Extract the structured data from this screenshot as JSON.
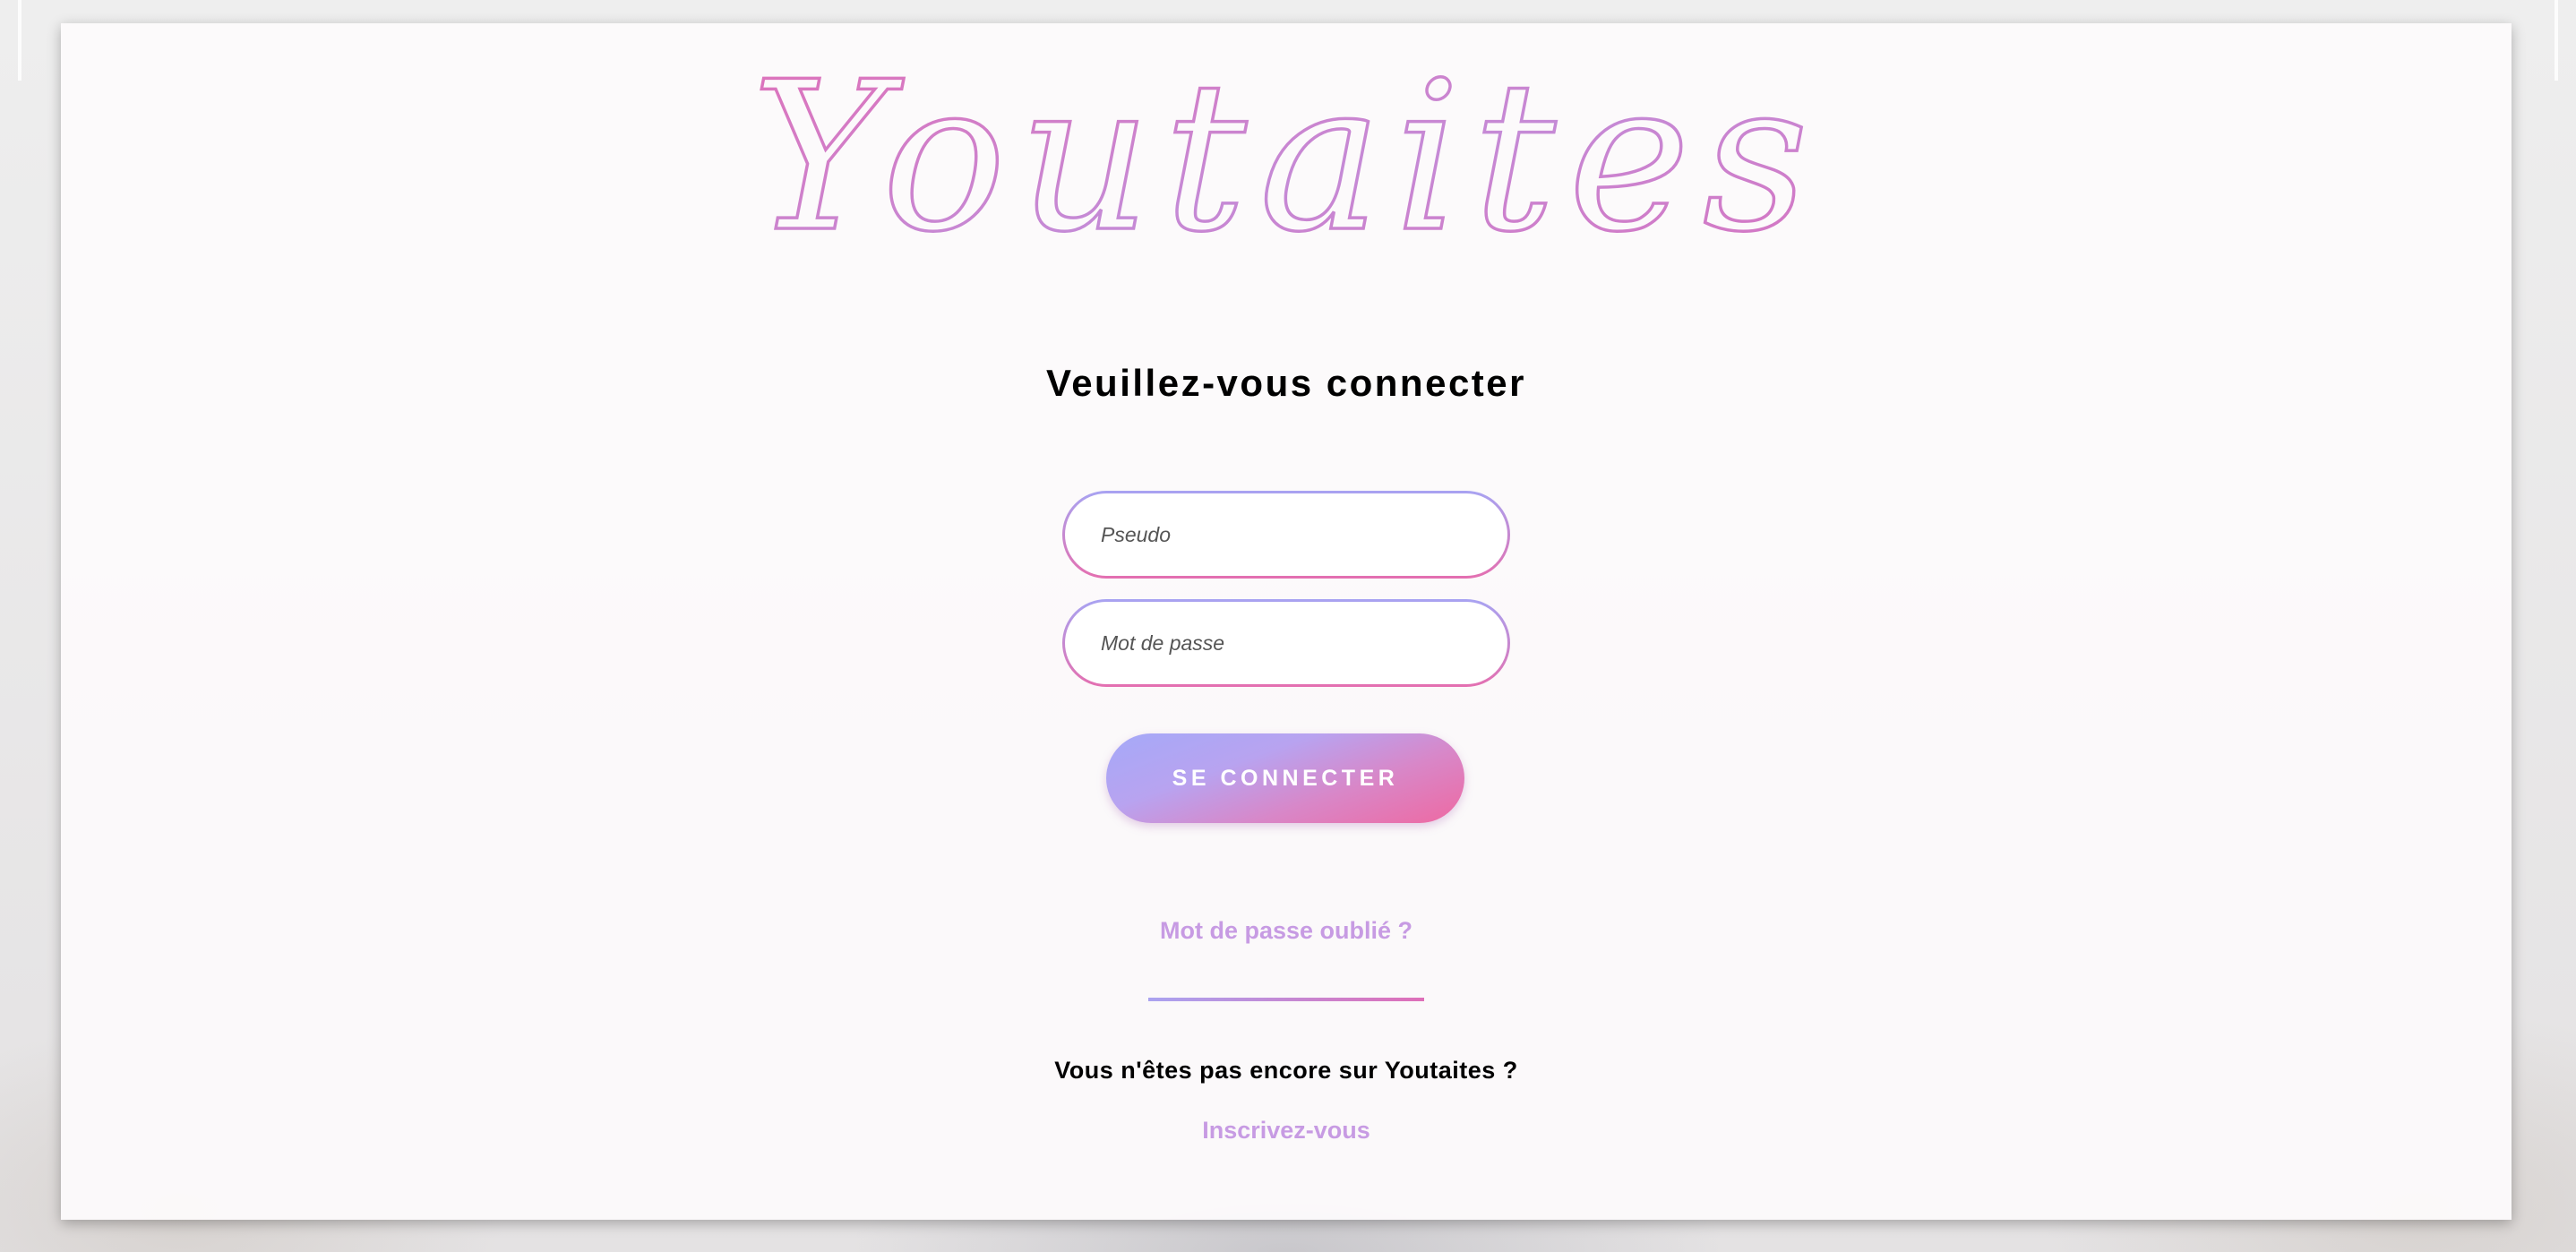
{
  "logo": {
    "text": "Youtaites"
  },
  "login": {
    "title": "Veuillez-vous connecter",
    "pseudo_placeholder": "Pseudo",
    "password_placeholder": "Mot de passe",
    "submit_label": "SE CONNECTER",
    "forgot_password": "Mot de passe oublié ?",
    "not_yet_text": "Vous n'êtes pas encore sur Youtaites ?",
    "signup_link": "Inscrivez-vous"
  },
  "colors": {
    "gradient_start": "#a8a3f2",
    "gradient_end": "#e46fb0",
    "link": "#c79be3"
  }
}
